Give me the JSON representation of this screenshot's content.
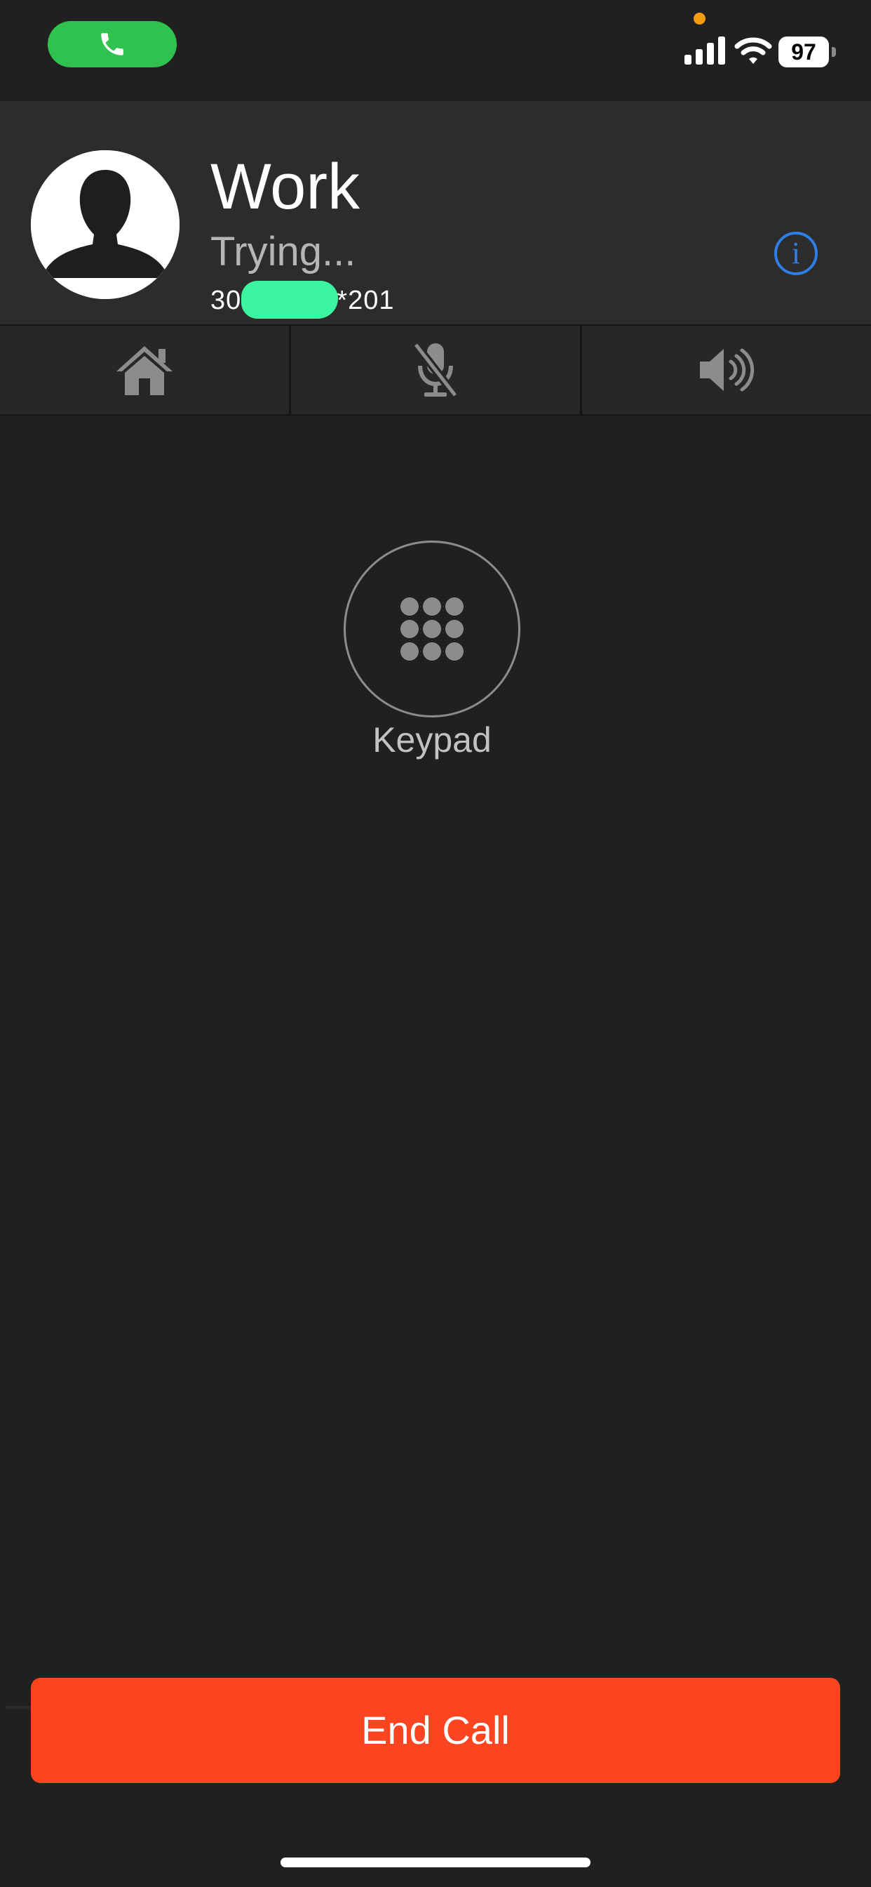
{
  "status_bar": {
    "call_pill_color": "#30c24f",
    "call_icon": "phone-icon",
    "privacy_dot_color": "#f39c12",
    "signal_icon": "cellular-signal-icon",
    "wifi_icon": "wifi-icon",
    "battery_level": "97"
  },
  "contact": {
    "name": "Work",
    "status": "Trying...",
    "number_prefix": "30",
    "number_suffix": "*201",
    "number_redaction_color": "#3cf5a0",
    "avatar_icon": "person-silhouette-icon",
    "info_icon": "info-icon",
    "info_glyph": "i",
    "info_color": "#2f7ee6"
  },
  "controls": [
    {
      "icon": "home-icon",
      "label": "Home"
    },
    {
      "icon": "mute-microphone-icon",
      "label": "Mute"
    },
    {
      "icon": "speaker-icon",
      "label": "Speaker"
    }
  ],
  "keypad": {
    "icon": "keypad-icon",
    "label": "Keypad"
  },
  "end_call": {
    "label": "End Call",
    "color": "#fb4521"
  },
  "colors": {
    "background": "#202020",
    "header_background": "#2c2c2c",
    "control_background": "#262729",
    "icon_gray": "#8c8c8c"
  }
}
